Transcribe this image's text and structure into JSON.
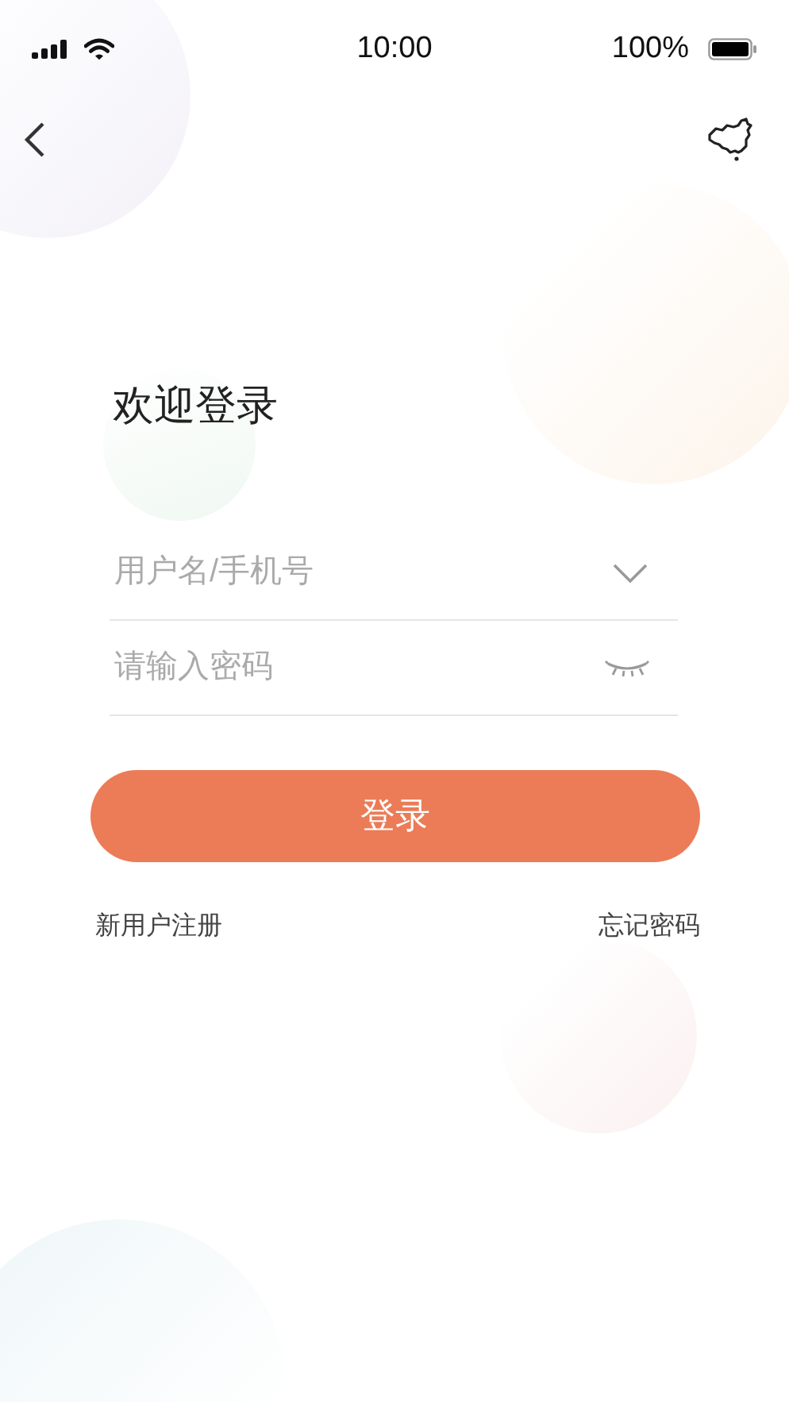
{
  "status_bar": {
    "time": "10:00",
    "battery": "100%"
  },
  "title": "欢迎登录",
  "fields": [
    {
      "kind": "username",
      "placeholder": "用户名/手机号"
    },
    {
      "kind": "password",
      "placeholder": "请输入密码"
    }
  ],
  "login_button": "登录",
  "links": {
    "register": "新用户注册",
    "forgot": "忘记密码"
  }
}
